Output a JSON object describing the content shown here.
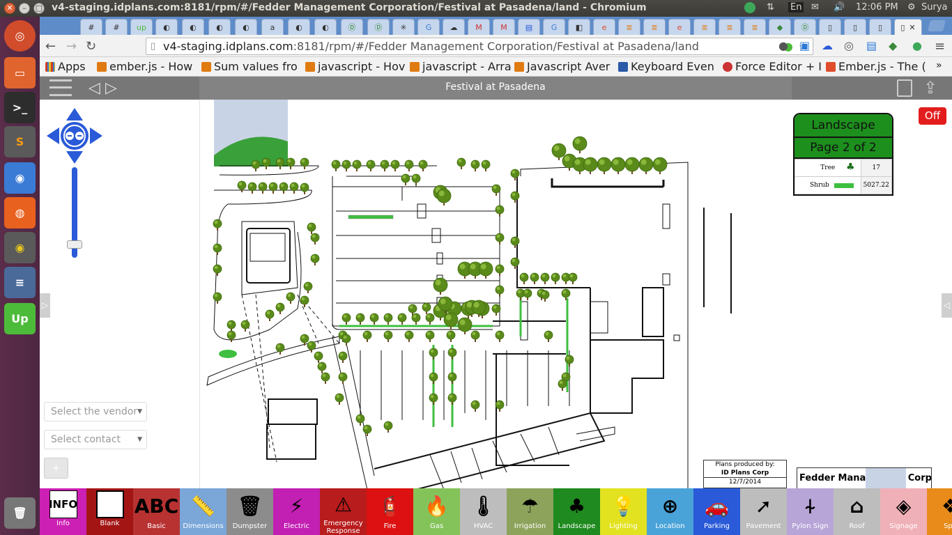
{
  "window": {
    "title": "v4-staging.idplans.com:8181/rpm/#/Fedder Management Corporation/Festival at Pasadena/land - Chromium",
    "tray_lang": "En",
    "clock": "12:06 PM",
    "user": "Surya"
  },
  "omnibox": {
    "host": "v4-staging.idplans.com",
    "rest": ":8181/rpm/#/Fedder Management Corporation/Festival at Pasadena/land"
  },
  "bookmarks": [
    {
      "label": "Apps",
      "color": "#d04020"
    },
    {
      "label": "ember.js - How",
      "color": "#e07b12"
    },
    {
      "label": "Sum values fro",
      "color": "#e07b12"
    },
    {
      "label": "javascript - Hov",
      "color": "#e07b12"
    },
    {
      "label": "javascript - Arra",
      "color": "#e07b12"
    },
    {
      "label": "Javascript Aver",
      "color": "#e07b12"
    },
    {
      "label": "Keyboard Even",
      "color": "#2a5aa8"
    },
    {
      "label": "Force Editor + I",
      "color": "#c33"
    },
    {
      "label": "Ember.js - The (",
      "color": "#e04c2c"
    }
  ],
  "app": {
    "title": "Festival at Pasadena",
    "vendor_placeholder": "Select the vendor",
    "contact_placeholder": "Select contact",
    "add_label": "+",
    "off_label": "Off"
  },
  "legend": {
    "title": "Landscape",
    "page": "Page 2 of 2",
    "rows": [
      {
        "label": "Tree",
        "value": "17",
        "icon": "tree-icon"
      },
      {
        "label": "Shrub",
        "value": "5027.22",
        "icon": "shrub-swatch"
      }
    ]
  },
  "titleblock": {
    "produced_by": "Plans produced by:",
    "company": "ID Plans Corp",
    "date": "12/7/2014",
    "owner": "Fedder Management Corporation"
  },
  "categories": [
    {
      "label": "Info",
      "color": "#cc1fb3",
      "icon": "info-icon"
    },
    {
      "label": "Blank",
      "color": "#a31515",
      "icon": "blank-icon"
    },
    {
      "label": "Basic",
      "color": "#b83232",
      "icon": "abc-icon"
    },
    {
      "label": "Dimensions",
      "color": "#7aa6d8",
      "icon": "ruler-icon"
    },
    {
      "label": "Dumpster",
      "color": "#8c8c8c",
      "icon": "dumpster-icon"
    },
    {
      "label": "Electric",
      "color": "#c21fb3",
      "icon": "lightning-icon"
    },
    {
      "label": "Emergency Response",
      "color": "#b81c1c",
      "icon": "warning-icon"
    },
    {
      "label": "Fire",
      "color": "#d11",
      "icon": "hydrant-icon"
    },
    {
      "label": "Gas",
      "color": "#84c35a",
      "icon": "flame-icon"
    },
    {
      "label": "HVAC",
      "color": "#bdbdbd",
      "icon": "thermometer-icon"
    },
    {
      "label": "Irrigation",
      "color": "#8da35c",
      "icon": "rain-icon"
    },
    {
      "label": "Landscape",
      "color": "#1f8a1f",
      "icon": "tree-icon"
    },
    {
      "label": "Lighting",
      "color": "#e2e220",
      "icon": "bulb-icon"
    },
    {
      "label": "Location",
      "color": "#4aa3d8",
      "icon": "plus-circle-icon"
    },
    {
      "label": "Parking",
      "color": "#2a5ad8",
      "icon": "car-icon"
    },
    {
      "label": "Pavement",
      "color": "#bdbdbd",
      "icon": "arrow-icon"
    },
    {
      "label": "Pylon Sign",
      "color": "#b8a5d8",
      "icon": "signpost-icon"
    },
    {
      "label": "Roof",
      "color": "#bdbdbd",
      "icon": "house-icon"
    },
    {
      "label": "Signage",
      "color": "#f0b0b8",
      "icon": "turn-sign-icon"
    },
    {
      "label": "Spa",
      "color": "#e88b1a",
      "icon": "spa-icon"
    }
  ]
}
